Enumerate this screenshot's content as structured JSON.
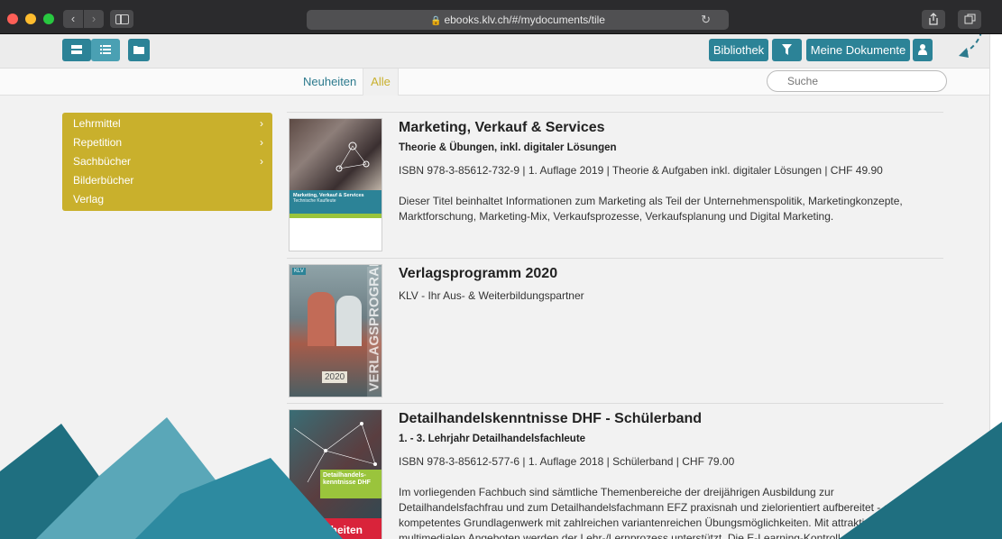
{
  "browser": {
    "url": "ebooks.klv.ch/#/mydocuments/tile",
    "back_glyph": "‹",
    "forward_glyph": "›",
    "reload_glyph": "↻"
  },
  "toolbar": {
    "library_label": "Bibliothek",
    "my_documents_label": "Meine Dokumente",
    "accent_color": "#2c8397"
  },
  "tabs": {
    "new_label": "Neuheiten",
    "all_label": "Alle",
    "active": "Alle"
  },
  "search": {
    "placeholder": "Suche"
  },
  "categories": {
    "color": "#c9b02c",
    "items": [
      {
        "label": "Lehrmittel",
        "chevron": "›"
      },
      {
        "label": "Repetition",
        "chevron": "›"
      },
      {
        "label": "Sachbücher",
        "chevron": "›"
      },
      {
        "label": "Bilderbücher",
        "chevron": ""
      },
      {
        "label": "Verlag",
        "chevron": ""
      }
    ]
  },
  "books": [
    {
      "title": "Marketing, Verkauf & Services",
      "subtitle": "Theorie & Übungen, inkl. digitaler Lösungen",
      "meta": "ISBN 978-3-85612-732-9 | 1. Auflage 2019 | Theorie & Aufgaben inkl. digitaler Lösungen | CHF 49.90",
      "description": "Dieser Titel beinhaltet Informationen zum Marketing als Teil der Unternehmenspolitik, Marketingkonzepte, Marktforschung, Marketing-Mix, Verkaufsprozesse, Verkaufsplanung und Digital Marketing.",
      "cover_title": "Marketing, Verkauf & Services",
      "cover_subtitle": "Technische Kaufleute"
    },
    {
      "title": "Verlagsprogramm 2020",
      "subtitle": "KLV - Ihr Aus- & Weiterbildungspartner",
      "cover_vertical": "VERLAGSPROGRAMM",
      "cover_year": "2020",
      "cover_logo": "KLV"
    },
    {
      "title": "Detailhandelskenntnisse DHF - Schülerband",
      "subtitle": "1. - 3. Lehrjahr Detailhandelsfachleute",
      "meta": "ISBN 978-3-85612-577-6 | 1. Auflage 2018 | Schülerband | CHF 79.00",
      "description": "Im vorliegenden Fachbuch sind sämtliche Themenbereiche der dreijährigen Ausbildung zur Detailhandelsfachfrau und zum Detailhandelsfachmann EFZ praxisnah und zielorientiert aufbereitet - ein kompetentes Grundlagenwerk mit zahlreichen variantenreichen Übungsmöglichkeiten. Mit attraktiven multimedialen Angeboten werden der Lehr-/Lernprozess unterstützt. Die E-Learning-Kontroll- und -Lernfragen decken die Lernziele und",
      "cover_title": "Detailhandels-kenntnisse DHF",
      "cover_badge": "Neuheiten"
    }
  ]
}
